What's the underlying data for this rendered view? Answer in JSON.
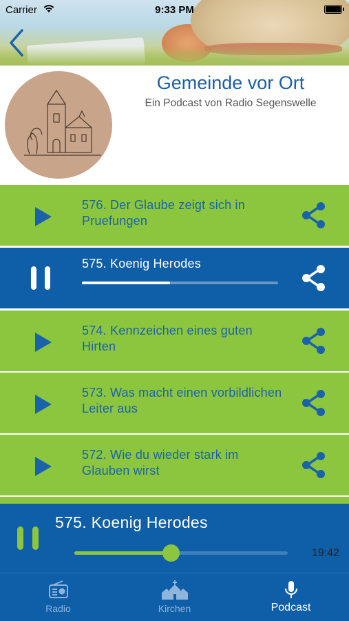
{
  "status_bar": {
    "carrier": "Carrier",
    "time": "9:33 PM"
  },
  "header": {
    "back_icon": "chevron-left-icon"
  },
  "podcast": {
    "title": "Gemeinde vor Ort",
    "subtitle": "Ein Podcast von Radio Segenswelle",
    "cover_icon": "church-drawing-icon"
  },
  "episodes": [
    {
      "title": "576. Der Glaube zeigt sich in Pruefungen",
      "state": "paused"
    },
    {
      "title": "575. Koenig Herodes",
      "state": "playing",
      "progress": 0.45
    },
    {
      "title": "574. Kennzeichen eines guten Hirten",
      "state": "paused"
    },
    {
      "title": "573. Was macht einen vorbildlichen Leiter aus",
      "state": "paused"
    },
    {
      "title": "572. Wie du wieder stark im Glauben wirst",
      "state": "paused"
    }
  ],
  "player": {
    "title": "575. Koenig Herodes",
    "time": "19:42",
    "progress": 0.45
  },
  "tabs": [
    {
      "label": "Radio",
      "icon": "radio-icon",
      "selected": false
    },
    {
      "label": "Kirchen",
      "icon": "church-icon",
      "selected": false
    },
    {
      "label": "Podcast",
      "icon": "microphone-icon",
      "selected": true
    }
  ],
  "colors": {
    "green": "#8cc63f",
    "blue": "#0e5ea8",
    "title_blue": "#1a5fa3"
  }
}
